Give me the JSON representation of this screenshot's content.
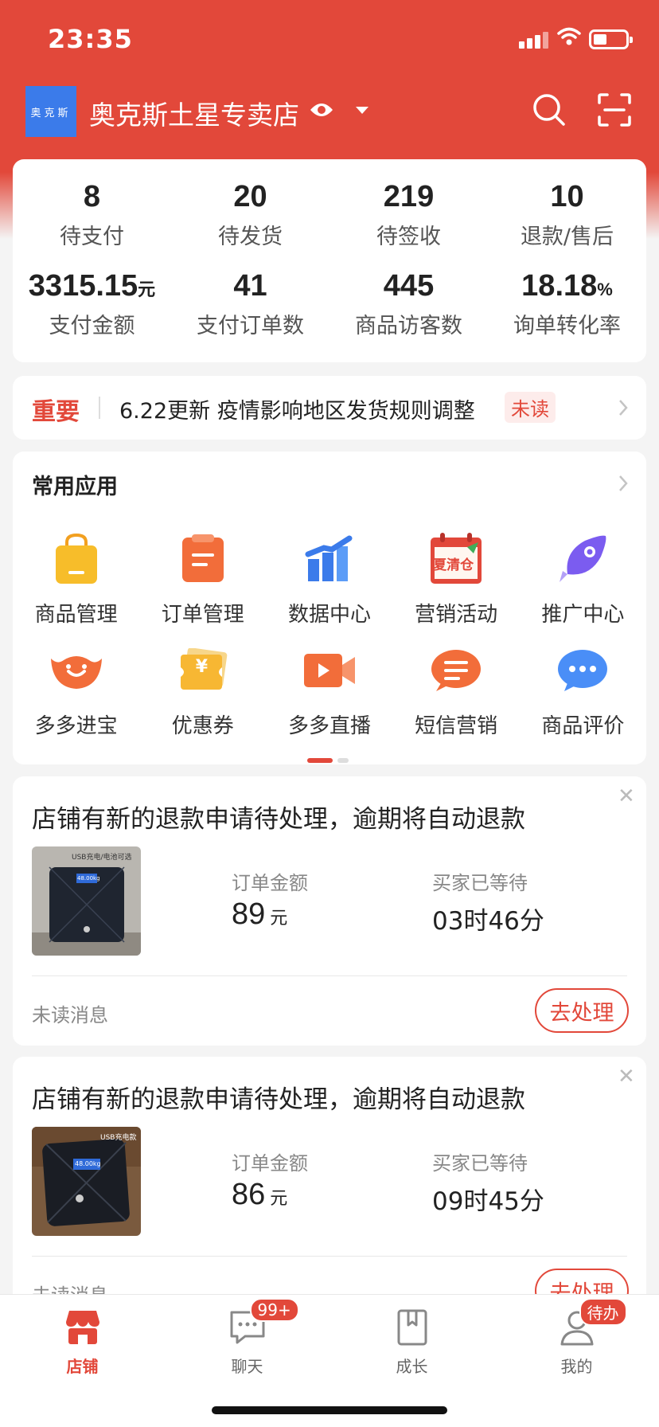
{
  "status_bar": {
    "time": "23:35"
  },
  "header": {
    "logo_text": "奥克斯",
    "shop_name": "奥克斯土星专卖店"
  },
  "stats": {
    "row1": [
      {
        "value": "8",
        "label": "待支付"
      },
      {
        "value": "20",
        "label": "待发货"
      },
      {
        "value": "219",
        "label": "待签收"
      },
      {
        "value": "10",
        "label": "退款/售后"
      }
    ],
    "row2": [
      {
        "value": "3315.15",
        "unit": "元",
        "label": "支付金额"
      },
      {
        "value": "41",
        "unit": "",
        "label": "支付订单数"
      },
      {
        "value": "445",
        "unit": "",
        "label": "商品访客数"
      },
      {
        "value": "18.18",
        "unit": "%",
        "label": "询单转化率"
      }
    ]
  },
  "notice": {
    "tag": "重要",
    "text": "6.22更新 疫情影响地区发货规则调整",
    "badge": "未读"
  },
  "apps": {
    "title": "常用应用",
    "items": [
      {
        "label": "商品管理",
        "icon": "shopping-bag-icon"
      },
      {
        "label": "订单管理",
        "icon": "order-icon"
      },
      {
        "label": "数据中心",
        "icon": "bar-chart-icon"
      },
      {
        "label": "营销活动",
        "icon": "calendar-sale-icon",
        "icon_text": "夏清仓"
      },
      {
        "label": "推广中心",
        "icon": "rocket-icon"
      },
      {
        "label": "多多进宝",
        "icon": "treasure-icon"
      },
      {
        "label": "优惠券",
        "icon": "coupon-icon",
        "icon_text": "¥"
      },
      {
        "label": "多多直播",
        "icon": "video-icon"
      },
      {
        "label": "短信营销",
        "icon": "sms-icon"
      },
      {
        "label": "商品评价",
        "icon": "chat-bubble-icon"
      }
    ]
  },
  "refunds": [
    {
      "title": "店铺有新的退款申请待处理，逾期将自动退款",
      "amount_label": "订单金额",
      "amount": "89",
      "amount_unit": "元",
      "wait_label": "买家已等待",
      "wait": "03时46分",
      "unread": "未读消息",
      "action": "去处理",
      "thumb_text": "USB充电/电池可选",
      "thumb_display": "48.00kg"
    },
    {
      "title": "店铺有新的退款申请待处理，逾期将自动退款",
      "amount_label": "订单金额",
      "amount": "86",
      "amount_unit": "元",
      "wait_label": "买家已等待",
      "wait": "09时45分",
      "unread": "未读消息",
      "action": "去处理",
      "thumb_text": "USB充电款",
      "thumb_display": "48.00kg"
    }
  ],
  "tabbar": [
    {
      "label": "店铺",
      "icon": "store-icon",
      "active": true,
      "badge": ""
    },
    {
      "label": "聊天",
      "icon": "chat-icon",
      "active": false,
      "badge": "99+"
    },
    {
      "label": "成长",
      "icon": "book-icon",
      "active": false,
      "badge": ""
    },
    {
      "label": "我的",
      "icon": "profile-icon",
      "active": false,
      "badge": "待办"
    }
  ],
  "colors": {
    "brand": "#e2483a",
    "background": "#f4f4f4"
  }
}
